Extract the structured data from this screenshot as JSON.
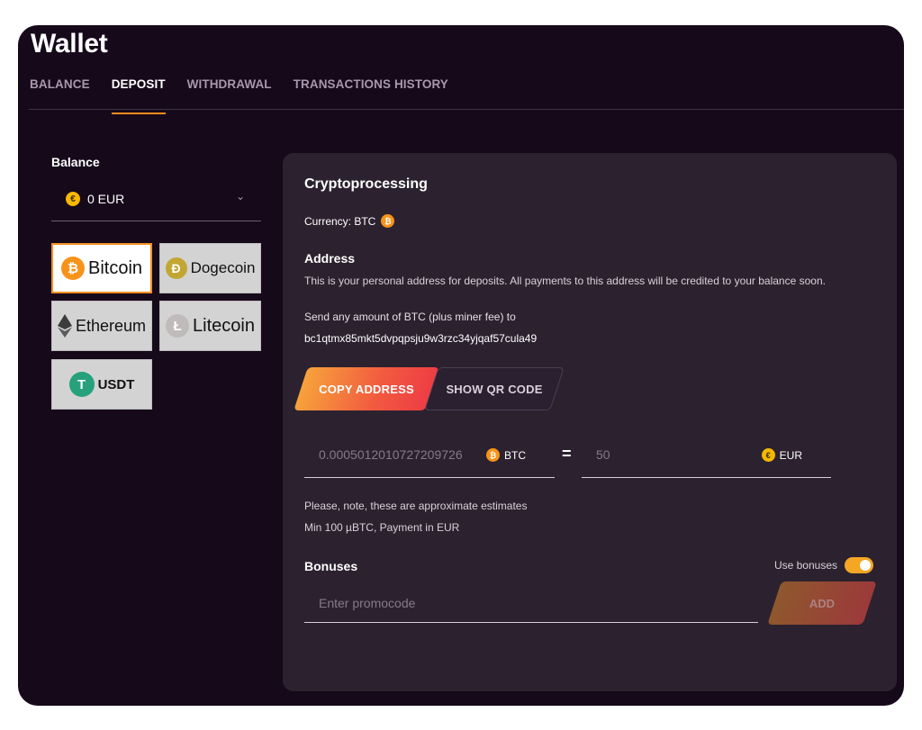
{
  "page": {
    "title": "Wallet"
  },
  "tabs": [
    {
      "label": "BALANCE"
    },
    {
      "label": "DEPOSIT"
    },
    {
      "label": "WITHDRAWAL"
    },
    {
      "label": "TRANSACTIONS HISTORY"
    }
  ],
  "active_tab": "DEPOSIT",
  "balance": {
    "label": "Balance",
    "value": "0 EUR",
    "currency_icon": "euro-coin-icon"
  },
  "payment_methods": [
    {
      "label": "Bitcoin",
      "icon": "bitcoin-icon",
      "icon_glyph": "₿",
      "icon_color": "#f7931a",
      "selected": true
    },
    {
      "label": "Dogecoin",
      "icon": "dogecoin-icon",
      "icon_glyph": "Ð",
      "icon_color": "#c2a633",
      "selected": false
    },
    {
      "label": "Ethereum",
      "icon": "ethereum-icon",
      "icon_glyph": "◆",
      "icon_color": "#3c3c3d",
      "selected": false
    },
    {
      "label": "Litecoin",
      "icon": "litecoin-icon",
      "icon_glyph": "Ł",
      "icon_color": "#bfbbbb",
      "selected": false
    },
    {
      "label": "USDT",
      "icon": "tether-icon",
      "icon_glyph": "T",
      "icon_color": "#26a17b",
      "selected": false
    }
  ],
  "crypto": {
    "title": "Cryptoprocessing",
    "currency_line": "Currency: BTC",
    "address_title": "Address",
    "address_desc": "This is your personal address for deposits. All payments to this address will be credited to your balance soon.",
    "send_text": "Send any amount of BTC (plus miner fee) to",
    "address": "bc1qtmx85mkt5dvpqpsju9w3rzc34yjqaf57cula49",
    "copy_label": "COPY ADDRESS",
    "qr_label": "SHOW QR CODE"
  },
  "converter": {
    "crypto_amount": "0.0005012010727209726",
    "crypto_unit": "BTC",
    "equals": "=",
    "fiat_amount": "50",
    "fiat_unit": "EUR"
  },
  "notes": {
    "approx": "Please, note, these are approximate estimates",
    "min": "Min 100 µBTC, Payment in EUR"
  },
  "bonuses": {
    "title": "Bonuses",
    "use_label": "Use bonuses",
    "use_enabled": true,
    "promo_placeholder": "Enter promocode",
    "add_label": "ADD"
  },
  "colors": {
    "accent": "#f39121",
    "background": "#16091a",
    "panel": "#2c222f"
  }
}
